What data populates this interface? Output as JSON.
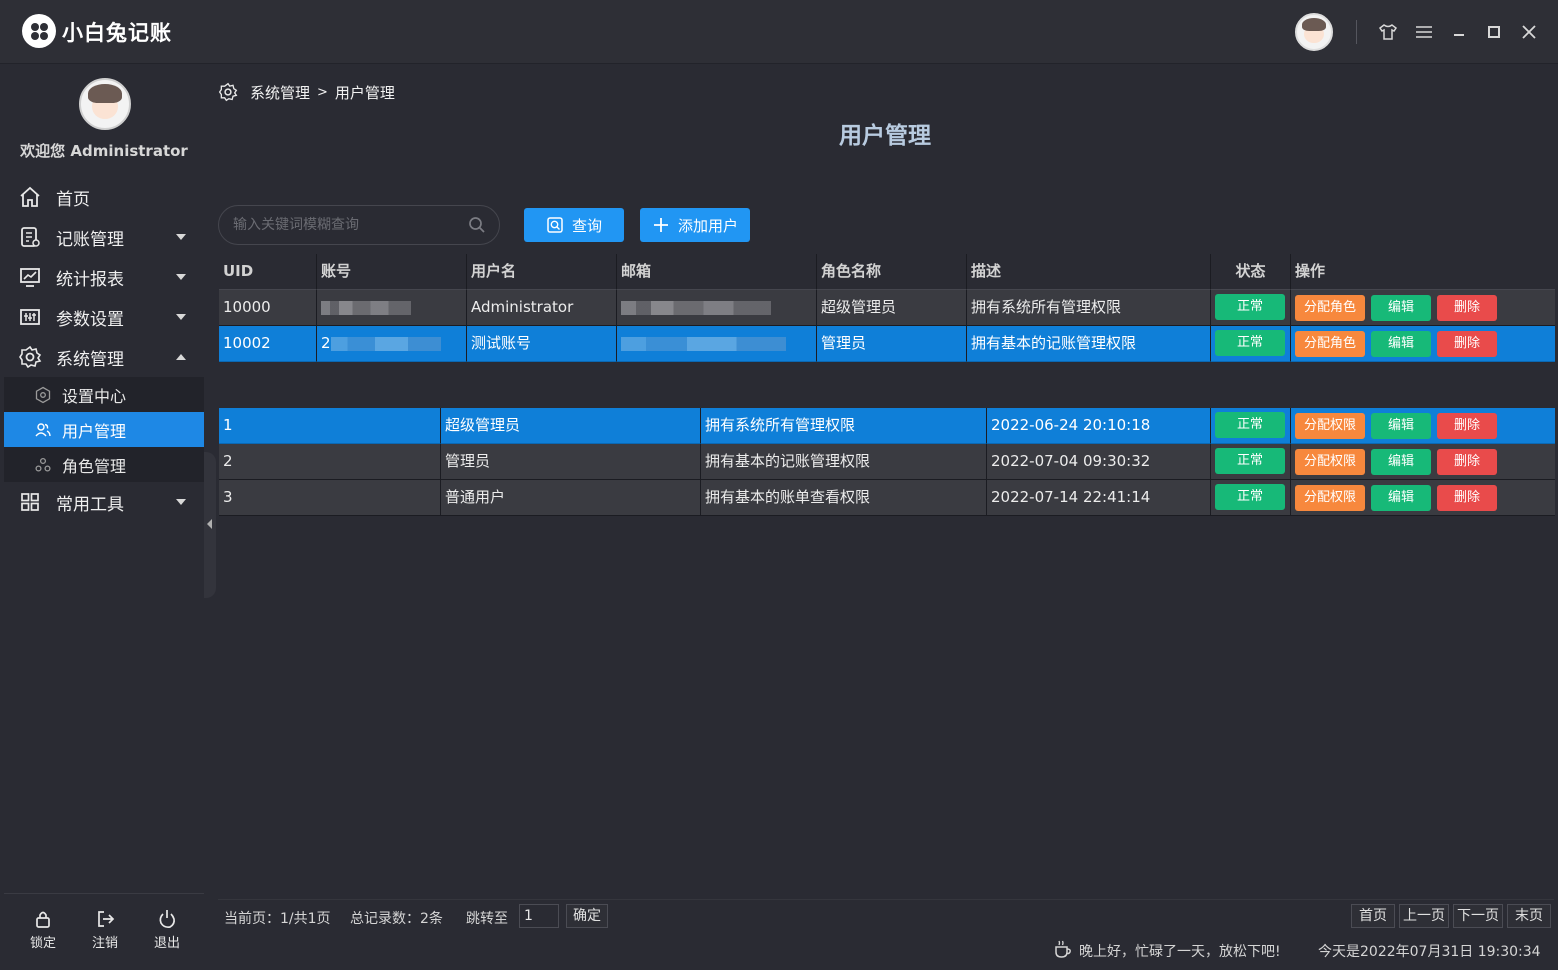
{
  "app": {
    "title": "小白兔记账",
    "colors": {
      "accent": "#2196f3",
      "active": "#0f7fd8",
      "success": "#17b978",
      "warning": "#f7883d",
      "danger": "#e94b4b"
    }
  },
  "sidebar": {
    "welcome": "欢迎您 Administrator",
    "items": [
      {
        "label": "首页",
        "icon": "home-icon"
      },
      {
        "label": "记账管理",
        "icon": "ledger-icon"
      },
      {
        "label": "统计报表",
        "icon": "chart-icon"
      },
      {
        "label": "参数设置",
        "icon": "params-icon"
      },
      {
        "label": "系统管理",
        "icon": "gear-icon"
      },
      {
        "label": "常用工具",
        "icon": "grid-icon"
      }
    ],
    "sub_items": [
      {
        "label": "设置中心"
      },
      {
        "label": "用户管理"
      },
      {
        "label": "角色管理"
      }
    ],
    "bottom": {
      "lock": "锁定",
      "logout": "注销",
      "exit": "退出"
    }
  },
  "breadcrumb": {
    "parent": "系统管理",
    "sep": ">",
    "current": "用户管理"
  },
  "page_title": "用户管理",
  "search": {
    "placeholder": "输入关键词模糊查询",
    "query_label": "查询",
    "add_label": "添加用户"
  },
  "users": {
    "headers": [
      "UID",
      "账号",
      "用户名",
      "邮箱",
      "角色名称",
      "描述",
      "状态",
      "操作"
    ],
    "rows": [
      {
        "uid": "10000",
        "username": "Administrator",
        "role": "超级管理员",
        "desc": "拥有系统所有管理权限",
        "status": "正常"
      },
      {
        "uid": "10002",
        "account_visible": "2",
        "username": "测试账号",
        "role": "管理员",
        "desc": "拥有基本的记账管理权限",
        "status": "正常"
      }
    ],
    "ops": {
      "assign": "分配角色",
      "edit": "编辑",
      "delete": "删除"
    }
  },
  "roles": {
    "rows": [
      {
        "id": "1",
        "name": "超级管理员",
        "desc": "拥有系统所有管理权限",
        "time": "2022-06-24 20:10:18",
        "status": "正常"
      },
      {
        "id": "2",
        "name": "管理员",
        "desc": "拥有基本的记账管理权限",
        "time": "2022-07-04 09:30:32",
        "status": "正常"
      },
      {
        "id": "3",
        "name": "普通用户",
        "desc": "拥有基本的账单查看权限",
        "time": "2022-07-14 22:41:14",
        "status": "正常"
      }
    ],
    "ops": {
      "assign": "分配权限",
      "edit": "编辑",
      "delete": "删除"
    }
  },
  "pager": {
    "current": "当前页：1/共1页",
    "total": "总记录数：2条",
    "jump": "跳转至",
    "jump_value": "1",
    "confirm": "确定",
    "first": "首页",
    "prev": "上一页",
    "next": "下一页",
    "last": "末页"
  },
  "footer": {
    "greeting": "晚上好，忙碌了一天，放松下吧!",
    "date": "今天是2022年07月31日 19:30:34"
  }
}
